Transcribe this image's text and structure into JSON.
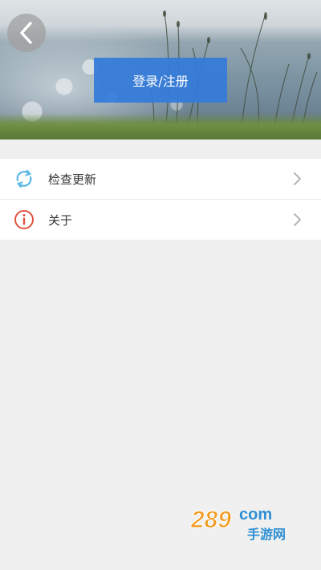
{
  "header": {
    "login_label": "登录/注册",
    "back_icon": "chevron-left-icon"
  },
  "menu": {
    "items": [
      {
        "label": "检查更新",
        "icon": "refresh-icon",
        "icon_color": "#5ab7e6"
      },
      {
        "label": "关于",
        "icon": "info-icon",
        "icon_color": "#e2533f"
      }
    ]
  },
  "watermark": {
    "text": "289",
    "suffix": "com",
    "subtitle": "手游网",
    "colors": {
      "orange": "#f29a1e",
      "blue": "#2e8fd4"
    }
  },
  "colors": {
    "accent": "#347bd9",
    "background": "#f0f0f0"
  }
}
